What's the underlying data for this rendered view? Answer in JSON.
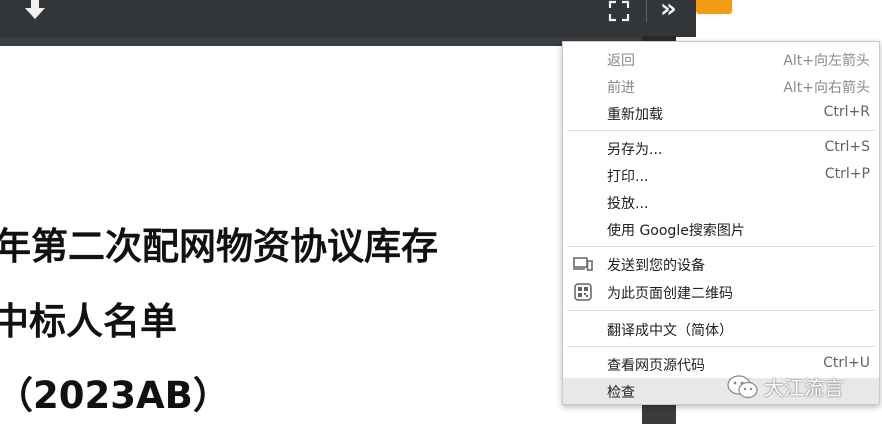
{
  "document": {
    "lines": [
      "年第二次配网物资协议库存",
      "中标人名单",
      "（2023AB）"
    ]
  },
  "toolbar": {
    "download_icon": "download-icon",
    "fullscreen_icon": "fullscreen-icon",
    "more_icon": "double-chevron-right-icon",
    "more_glyph": "»"
  },
  "context_menu": {
    "back": {
      "label": "返回",
      "shortcut": "Alt+向左箭头"
    },
    "forward": {
      "label": "前进",
      "shortcut": "Alt+向右箭头"
    },
    "reload": {
      "label": "重新加载",
      "shortcut": "Ctrl+R"
    },
    "save_as": {
      "label": "另存为...",
      "shortcut": "Ctrl+S"
    },
    "print": {
      "label": "打印...",
      "shortcut": "Ctrl+P"
    },
    "cast": {
      "label": "投放..."
    },
    "search_image": {
      "label": "使用 Google搜索图片"
    },
    "send_to_devices": {
      "label": "发送到您的设备",
      "icon": "devices-icon"
    },
    "create_qr": {
      "label": "为此页面创建二维码",
      "icon": "qr-code-icon"
    },
    "translate": {
      "label": "翻译成中文（简体）"
    },
    "view_source": {
      "label": "查看网页源代码",
      "shortcut": "Ctrl+U"
    },
    "inspect": {
      "label": "检查"
    }
  },
  "watermark": {
    "text": "大江流言",
    "icon": "wechat-icon"
  },
  "colors": {
    "toolbar": "#323639",
    "accent": "#f39c12",
    "menu_hover": "#e8e8e8"
  }
}
